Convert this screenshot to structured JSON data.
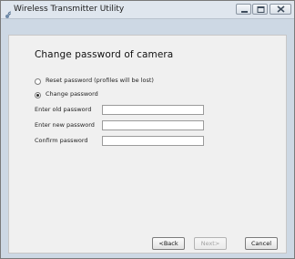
{
  "window": {
    "title": "Wireless Transmitter Utility",
    "app_icon": "transmitter-icon",
    "controls": {
      "minimize": "minimize-icon",
      "maximize": "maximize-icon",
      "close": "close-icon"
    }
  },
  "page": {
    "heading": "Change password of camera",
    "options": {
      "reset_label": "Reset password (profiles will be lost)",
      "change_label": "Change password",
      "selected": "change"
    },
    "fields": {
      "old_label": "Enter old password",
      "old_value": "",
      "new_label": "Enter new password",
      "new_value": "",
      "confirm_label": "Confirm password",
      "confirm_value": ""
    }
  },
  "footer": {
    "back": "<Back",
    "next": "Next>",
    "cancel": "Cancel"
  },
  "colors": {
    "titlebar": "#dfe6ee",
    "frame": "#cdd8e4",
    "client": "#f0f0f0"
  }
}
